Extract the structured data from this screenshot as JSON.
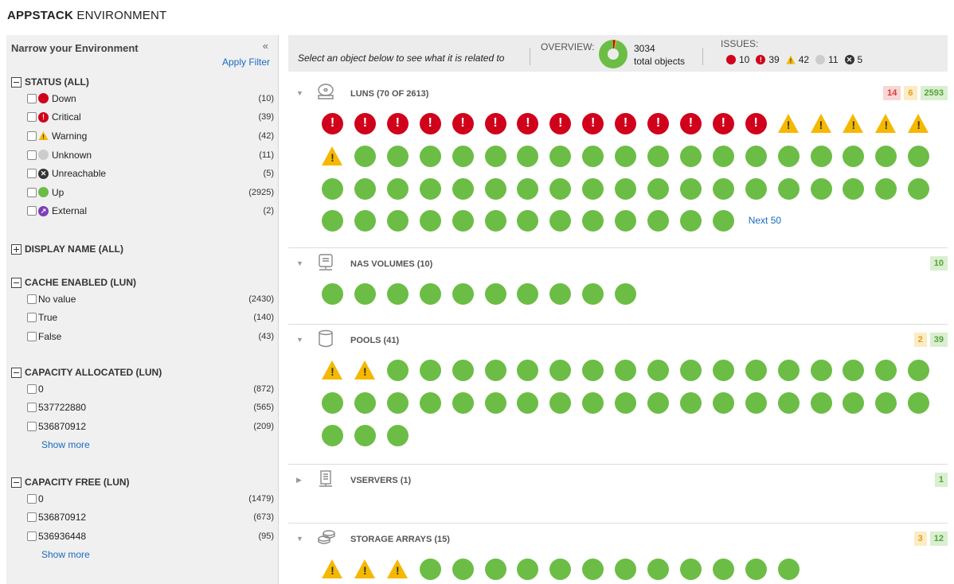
{
  "app": {
    "title_bold": "APPSTACK",
    "title_rest": " ENVIRONMENT"
  },
  "sidebar": {
    "heading": "Narrow your Environment",
    "collapse_icon": "«",
    "apply_filter": "Apply Filter",
    "status": {
      "title": "STATUS (ALL)",
      "items": [
        {
          "label": "Down",
          "count": "(10)",
          "icon": "down-icon",
          "color": "#d0021b"
        },
        {
          "label": "Critical",
          "count": "(39)",
          "icon": "critical-icon",
          "color": "#d0021b"
        },
        {
          "label": "Warning",
          "count": "(42)",
          "icon": "warning-icon",
          "color": "#f5b800"
        },
        {
          "label": "Unknown",
          "count": "(11)",
          "icon": "unknown-icon",
          "color": "#cccccc"
        },
        {
          "label": "Unreachable",
          "count": "(5)",
          "icon": "unreachable-icon",
          "color": "#333333"
        },
        {
          "label": "Up",
          "count": "(2925)",
          "icon": "up-icon",
          "color": "#6cbd45"
        },
        {
          "label": "External",
          "count": "(2)",
          "icon": "external-icon",
          "color": "#7b3fb7"
        }
      ]
    },
    "display_name": {
      "title": "DISPLAY NAME (ALL)"
    },
    "cache_enabled": {
      "title": "CACHE ENABLED (LUN)",
      "items": [
        {
          "label": "No value",
          "count": "(2430)"
        },
        {
          "label": "True",
          "count": "(140)"
        },
        {
          "label": "False",
          "count": "(43)"
        }
      ]
    },
    "capacity_allocated": {
      "title": "CAPACITY ALLOCATED (LUN)",
      "items": [
        {
          "label": "0",
          "count": "(872)"
        },
        {
          "label": "537722880",
          "count": "(565)"
        },
        {
          "label": "536870912",
          "count": "(209)"
        }
      ],
      "show_more": "Show more"
    },
    "capacity_free": {
      "title": "CAPACITY FREE (LUN)",
      "items": [
        {
          "label": "0",
          "count": "(1479)"
        },
        {
          "label": "536870912",
          "count": "(673)"
        },
        {
          "label": "536936448",
          "count": "(95)"
        }
      ],
      "show_more": "Show more"
    }
  },
  "topbar": {
    "hint": "Select an object below to see what it is related to",
    "overview_label": "OVERVIEW:",
    "overview_count": "3034",
    "overview_text": "total objects",
    "issues_label": "ISSUES:",
    "issues": [
      {
        "icon": "down-icon",
        "value": "10",
        "color": "#d0021b"
      },
      {
        "icon": "critical-icon",
        "value": "39",
        "color": "#d0021b"
      },
      {
        "icon": "warning-icon",
        "value": "42",
        "color": "#f5b800"
      },
      {
        "icon": "unknown-icon",
        "value": "11",
        "color": "#cccccc"
      },
      {
        "icon": "unreachable-icon",
        "value": "5",
        "color": "#333333"
      }
    ]
  },
  "sections": [
    {
      "title": "LUNS (70 OF 2613)",
      "icon": "lun-disk-icon",
      "expanded": true,
      "badges": [
        {
          "kind": "red",
          "value": "14"
        },
        {
          "kind": "yellow",
          "value": "6"
        },
        {
          "kind": "green",
          "value": "2593"
        }
      ],
      "status_counts": {
        "critical": 14,
        "warning": 6,
        "up": 50
      },
      "shown_items": 70,
      "next_label": "Next 50"
    },
    {
      "title": "NAS VOLUMES (10)",
      "icon": "nas-volume-icon",
      "expanded": true,
      "badges": [
        {
          "kind": "green",
          "value": "10"
        }
      ],
      "status_counts": {
        "critical": 0,
        "warning": 0,
        "up": 10
      }
    },
    {
      "title": "POOLS (41)",
      "icon": "pool-cylinder-icon",
      "expanded": true,
      "badges": [
        {
          "kind": "yellow",
          "value": "2"
        },
        {
          "kind": "green",
          "value": "39"
        }
      ],
      "status_counts": {
        "critical": 0,
        "warning": 2,
        "up": 39
      }
    },
    {
      "title": "VSERVERS (1)",
      "icon": "vserver-icon",
      "expanded": false,
      "badges": [
        {
          "kind": "green",
          "value": "1"
        }
      ],
      "status_counts": {
        "critical": 0,
        "warning": 0,
        "up": 0
      }
    },
    {
      "title": "STORAGE ARRAYS (15)",
      "icon": "storage-array-icon",
      "expanded": true,
      "badges": [
        {
          "kind": "yellow",
          "value": "3"
        },
        {
          "kind": "green",
          "value": "12"
        }
      ],
      "status_counts": {
        "critical": 0,
        "warning": 3,
        "up": 12
      }
    }
  ]
}
